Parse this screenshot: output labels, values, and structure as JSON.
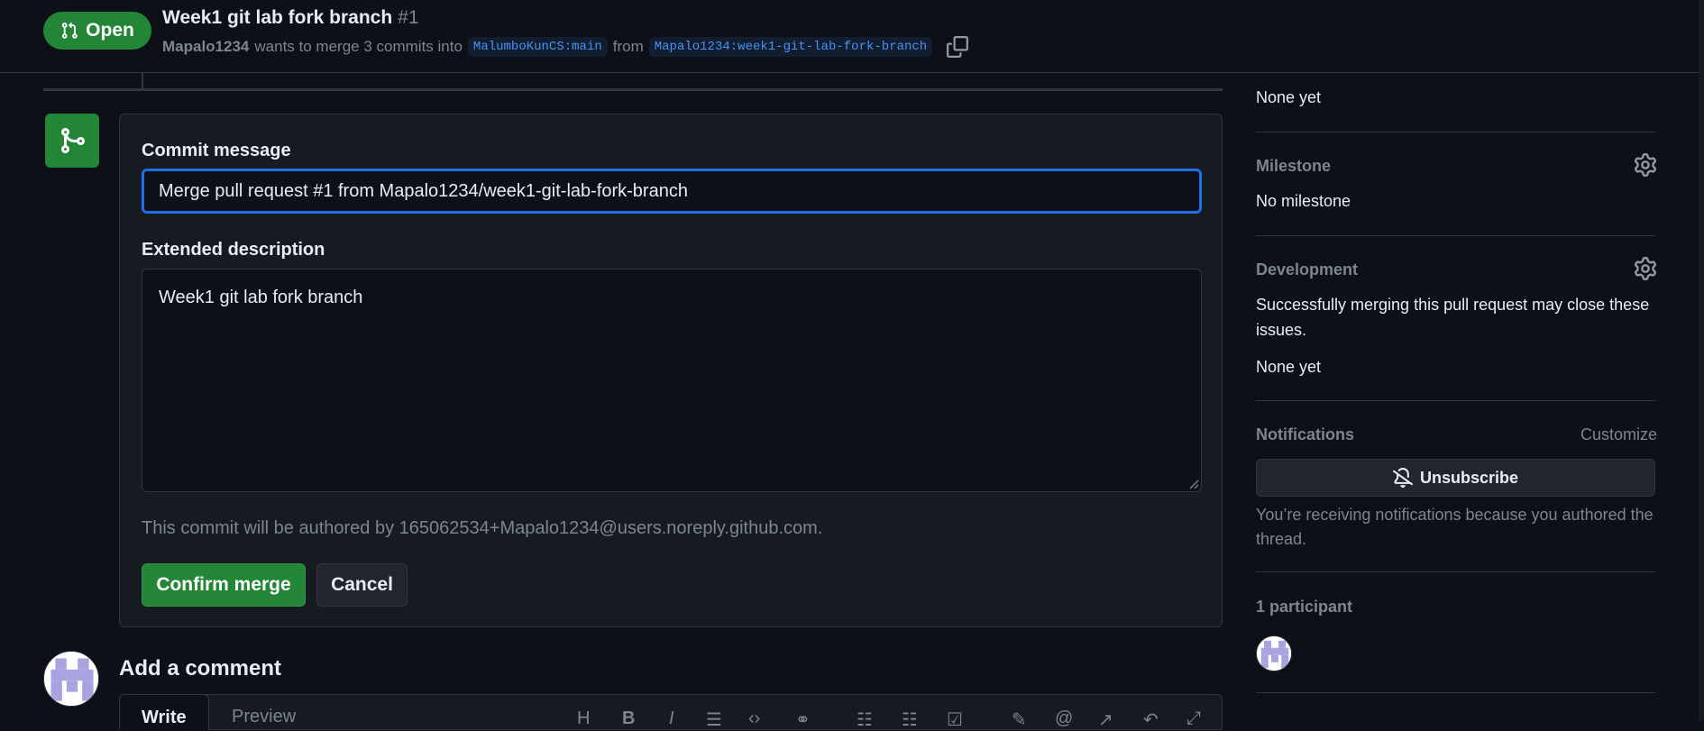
{
  "header": {
    "state_label": "Open",
    "title": "Week1 git lab fork branch",
    "number": "#1",
    "author": "Mapalo1234",
    "merge_text": "wants to merge 3 commits into",
    "base_branch": "MalumboKunCS:main",
    "from_text": "from",
    "head_branch": "Mapalo1234:week1-git-lab-fork-branch"
  },
  "merge_form": {
    "commit_message_label": "Commit message",
    "commit_message_value": "Merge pull request #1 from Mapalo1234/week1-git-lab-fork-branch",
    "extended_description_label": "Extended description",
    "extended_description_value": "Week1 git lab fork branch",
    "author_note": "This commit will be authored by 165062534+Mapalo1234@users.noreply.github.com.",
    "confirm_label": "Confirm merge",
    "cancel_label": "Cancel"
  },
  "comment": {
    "heading": "Add a comment",
    "tab_write": "Write",
    "tab_preview": "Preview"
  },
  "sidebar": {
    "labels_value": "None yet",
    "milestone_heading": "Milestone",
    "milestone_value": "No milestone",
    "development_heading": "Development",
    "development_text": "Successfully merging this pull request may close these issues.",
    "development_value": "None yet",
    "notifications_heading": "Notifications",
    "customize_label": "Customize",
    "unsubscribe_label": "Unsubscribe",
    "notifications_note": "You’re receiving notifications because you authored the thread.",
    "participants_heading": "1 participant"
  },
  "colors": {
    "accent_green": "#238636",
    "focus_blue": "#1f6feb",
    "background": "#0d1117",
    "muted_text": "#7d8590"
  },
  "icons": [
    "pull-request-icon",
    "copy-icon",
    "merge-icon",
    "gear-icon",
    "bell-slash-icon",
    "avatar-identicon"
  ]
}
